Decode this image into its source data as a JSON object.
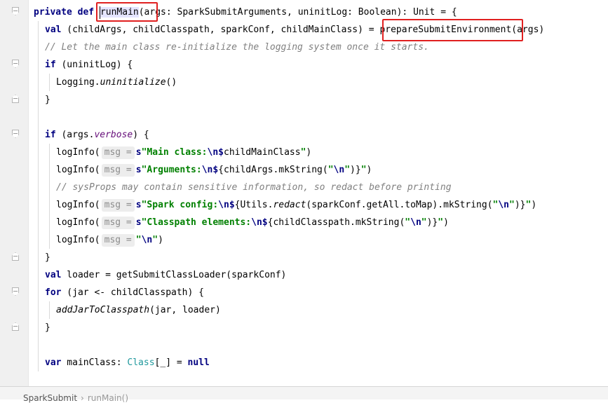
{
  "code": {
    "l1": {
      "kw_private": "private",
      "kw_def": "def",
      "method": "runMain",
      "rest": "(args: SparkSubmitArguments, uninitLog: Boolean): Unit = {"
    },
    "l2": {
      "kw": "val",
      "a": " (childArgs, childClasspath, sparkConf, childMainClass) = ",
      "call": "prepareSubmitEnvironment",
      "b": "(args)"
    },
    "l3": {
      "comment": "// Let the main class re-initialize the logging system once it starts."
    },
    "l4": {
      "kw": "if",
      "rest": " (uninitLog) {"
    },
    "l5": {
      "obj": "Logging.",
      "fn": "uninitialize",
      "rest": "()"
    },
    "l6": {
      "brace": "}"
    },
    "l7": {
      "kw": "if",
      "a": " (args.",
      "field": "verbose",
      "b": ") {"
    },
    "l8": {
      "fn": "logInfo(",
      "hint": "msg =",
      "s": "s",
      "str1": "\"Main class:",
      "esc": "\\n",
      "dollar": "$",
      "ident": "childMainClass",
      "str2": "\"",
      "close": ")"
    },
    "l9": {
      "fn": "logInfo(",
      "hint": "msg =",
      "s": "s",
      "str1": "\"Arguments:",
      "esc": "\\n",
      "dollar": "$",
      "expr": "{childArgs.mkString(",
      "q1": "\"",
      "esc2": "\\n",
      "q2": "\"",
      "expr2": ")}",
      "str2": "\"",
      "close": ")"
    },
    "l10": {
      "comment": "// sysProps may contain sensitive information, so redact before printing"
    },
    "l11": {
      "fn": "logInfo(",
      "hint": "msg =",
      "s": "s",
      "str1": "\"Spark config:",
      "esc": "\\n",
      "dollar": "$",
      "a": "{Utils.",
      "redact": "redact",
      "b": "(sparkConf.getAll.toMap).mkString(",
      "q1": "\"",
      "esc2": "\\n",
      "q2": "\"",
      "c": ")}",
      "str2": "\"",
      "close": ")"
    },
    "l12": {
      "fn": "logInfo(",
      "hint": "msg =",
      "s": "s",
      "str1": "\"Classpath elements:",
      "esc": "\\n",
      "dollar": "$",
      "expr": "{childClasspath.mkString(",
      "q1": "\"",
      "esc2": "\\n",
      "q2": "\"",
      "expr2": ")}",
      "str2": "\"",
      "close": ")"
    },
    "l13": {
      "fn": "logInfo(",
      "hint": "msg =",
      "q1": "\"",
      "esc": "\\n",
      "q2": "\"",
      "close": ")"
    },
    "l14": {
      "brace": "}"
    },
    "l15": {
      "kw": "val",
      "rest": " loader = getSubmitClassLoader(sparkConf)"
    },
    "l16": {
      "kw": "for",
      "rest": " (jar <- childClasspath) {"
    },
    "l17": {
      "fn": "addJarToClasspath",
      "rest": "(jar, loader)"
    },
    "l18": {
      "brace": "}"
    },
    "l19": {
      "kw": "var",
      "a": " mainClass: ",
      "type": "Class",
      "b": "[_] = ",
      "kw2": "null"
    }
  },
  "breadcrumb": {
    "file": "SparkSubmit",
    "separator": "›",
    "method": "runMain()"
  },
  "colors": {
    "keyword": "#000080",
    "comment": "#808080",
    "string": "#008000",
    "field": "#660e7a",
    "type": "#20999d",
    "highlight_box": "#e02020"
  }
}
